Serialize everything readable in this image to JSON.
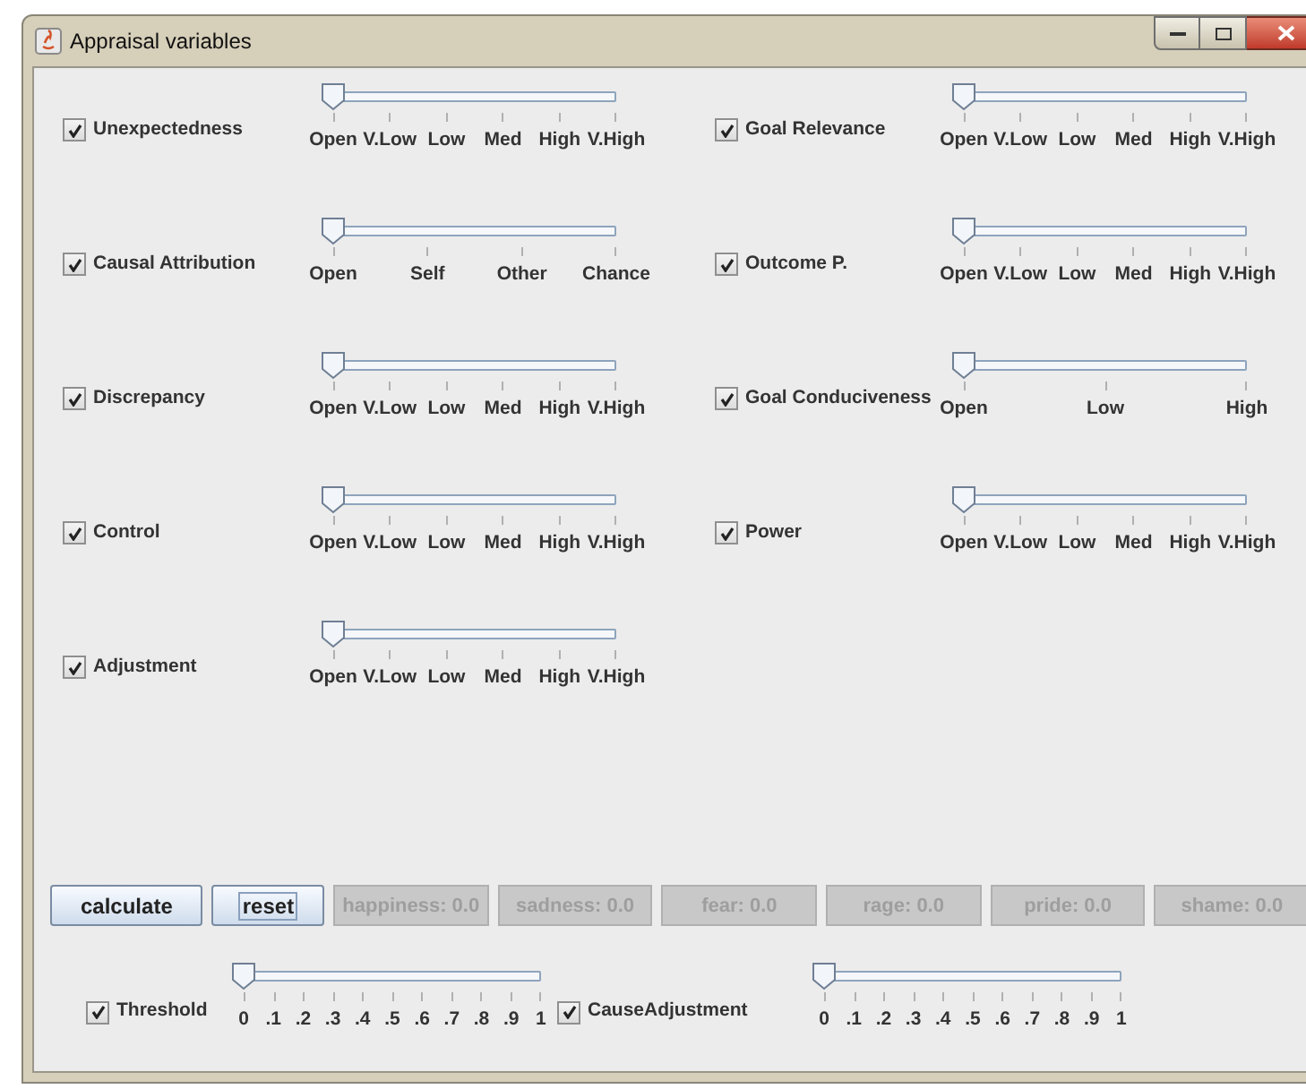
{
  "window": {
    "title": "Appraisal variables"
  },
  "variables": [
    {
      "label": "Unexpectedness",
      "checked": true,
      "level": 0,
      "tick_labels": [
        "Open",
        "V.Low",
        "Low",
        "Med",
        "High",
        "V.High"
      ]
    },
    {
      "label": "Goal Relevance",
      "checked": true,
      "level": 0,
      "tick_labels": [
        "Open",
        "V.Low",
        "Low",
        "Med",
        "High",
        "V.High"
      ]
    },
    {
      "label": "Causal Attribution",
      "checked": true,
      "level": 0,
      "tick_labels": [
        "Open",
        "Self",
        "Other",
        "Chance"
      ]
    },
    {
      "label": "Outcome P.",
      "checked": true,
      "level": 0,
      "tick_labels": [
        "Open",
        "V.Low",
        "Low",
        "Med",
        "High",
        "V.High"
      ]
    },
    {
      "label": "Discrepancy",
      "checked": true,
      "level": 0,
      "tick_labels": [
        "Open",
        "V.Low",
        "Low",
        "Med",
        "High",
        "V.High"
      ]
    },
    {
      "label": "Goal Conduciveness",
      "checked": true,
      "level": 0,
      "tick_labels": [
        "Open",
        "Low",
        "High"
      ]
    },
    {
      "label": "Control",
      "checked": true,
      "level": 0,
      "tick_labels": [
        "Open",
        "V.Low",
        "Low",
        "Med",
        "High",
        "V.High"
      ]
    },
    {
      "label": "Power",
      "checked": true,
      "level": 0,
      "tick_labels": [
        "Open",
        "V.Low",
        "Low",
        "Med",
        "High",
        "V.High"
      ]
    },
    {
      "label": "Adjustment",
      "checked": true,
      "level": 0,
      "tick_labels": [
        "Open",
        "V.Low",
        "Low",
        "Med",
        "High",
        "V.High"
      ]
    }
  ],
  "buttons": [
    {
      "label": "calculate",
      "focused": false
    },
    {
      "label": "reset",
      "focused": true
    }
  ],
  "results": [
    {
      "text": "happiness: 0.0",
      "disabled": true
    },
    {
      "text": "sadness: 0.0",
      "disabled": true
    },
    {
      "text": "fear: 0.0",
      "disabled": true
    },
    {
      "text": "rage: 0.0",
      "disabled": true
    },
    {
      "text": "pride: 0.0",
      "disabled": true
    },
    {
      "text": "shame: 0.0",
      "disabled": true
    }
  ],
  "parameters": [
    {
      "label": "Threshold",
      "checked": true,
      "level": 0,
      "tick_labels": [
        "0",
        ".1",
        ".2",
        ".3",
        ".4",
        ".5",
        ".6",
        ".7",
        ".8",
        ".9",
        "1"
      ]
    },
    {
      "label": "CauseAdjustment",
      "checked": true,
      "level": 0,
      "tick_labels": [
        "0",
        ".1",
        ".2",
        ".3",
        ".4",
        ".5",
        ".6",
        ".7",
        ".8",
        ".9",
        "1"
      ]
    }
  ]
}
